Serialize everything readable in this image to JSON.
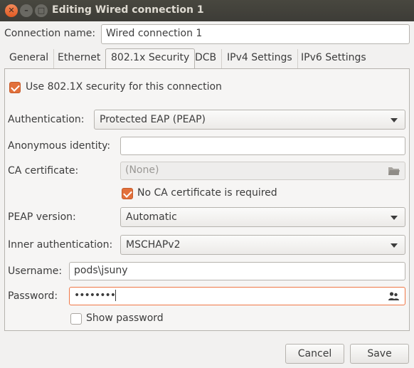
{
  "window": {
    "title": "Editing Wired connection 1"
  },
  "connection": {
    "name_label": "Connection name:",
    "name_value": "Wired connection 1"
  },
  "tabs": [
    {
      "label": "General"
    },
    {
      "label": "Ethernet"
    },
    {
      "label": "802.1x Security"
    },
    {
      "label": "DCB"
    },
    {
      "label": "IPv4 Settings"
    },
    {
      "label": "IPv6 Settings"
    }
  ],
  "active_tab": "802.1x Security",
  "security": {
    "use_8021x_label": "Use 802.1X security for this connection",
    "use_8021x_checked": true,
    "authentication_label": "Authentication:",
    "authentication_value": "Protected EAP (PEAP)",
    "anonymous_identity_label": "Anonymous identity:",
    "anonymous_identity_value": "",
    "ca_certificate_label": "CA certificate:",
    "ca_certificate_value": "(None)",
    "no_ca_required_label": "No CA certificate is required",
    "no_ca_required_checked": true,
    "peap_version_label": "PEAP version:",
    "peap_version_value": "Automatic",
    "inner_auth_label": "Inner authentication:",
    "inner_auth_value": "MSCHAPv2",
    "username_label": "Username:",
    "username_value": "pods\\jsuny",
    "password_label": "Password:",
    "password_value": "••••••••",
    "show_password_label": "Show password",
    "show_password_checked": false
  },
  "footer": {
    "cancel_label": "Cancel",
    "save_label": "Save"
  },
  "colors": {
    "accent": "#e2703b",
    "titlebar": "#3d3c37",
    "background": "#f2f1f0"
  }
}
